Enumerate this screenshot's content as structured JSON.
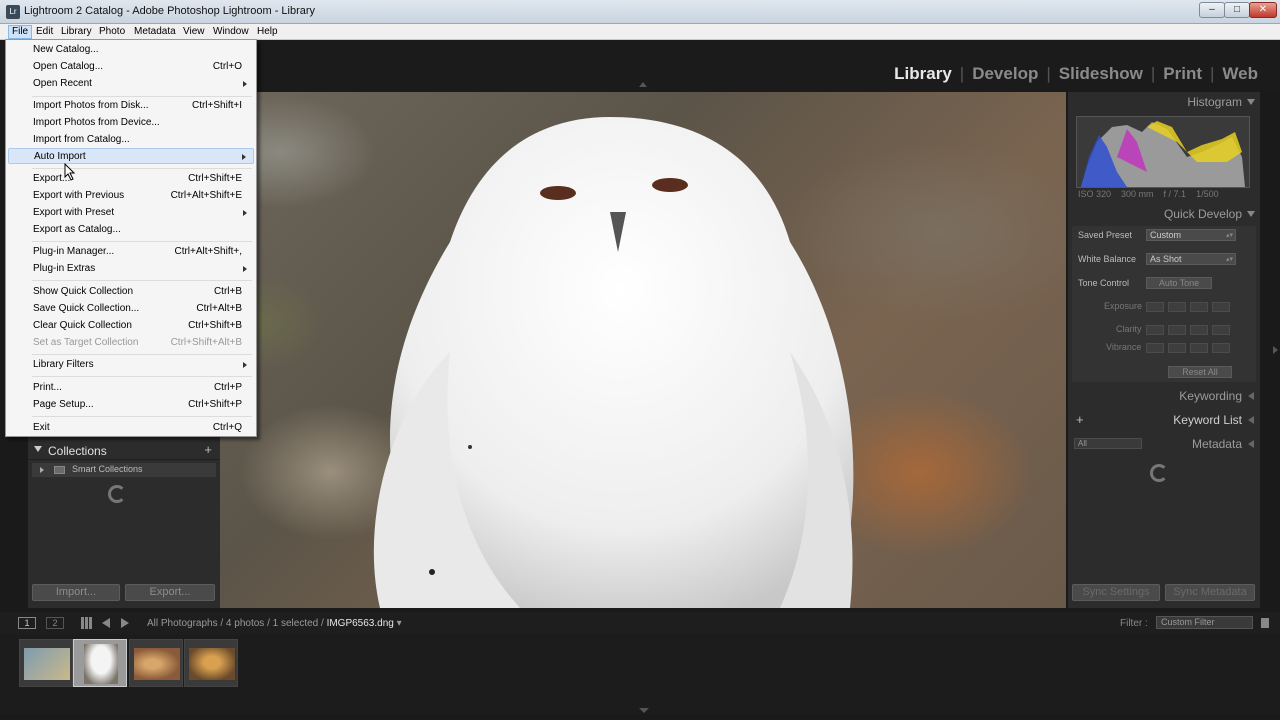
{
  "window": {
    "title": "Lightroom 2 Catalog - Adobe Photoshop Lightroom - Library",
    "app_icon": "Lr",
    "min": "–",
    "max": "□",
    "close": "✕"
  },
  "menubar": [
    "File",
    "Edit",
    "Library",
    "Photo",
    "Metadata",
    "View",
    "Window",
    "Help"
  ],
  "modules": {
    "items": [
      "Library",
      "Develop",
      "Slideshow",
      "Print",
      "Web"
    ],
    "separator": "|",
    "active": "Library"
  },
  "file_menu": [
    {
      "label": "New Catalog...",
      "shortcut": "",
      "submenu": false
    },
    {
      "label": "Open Catalog...",
      "shortcut": "Ctrl+O",
      "submenu": false
    },
    {
      "label": "Open Recent",
      "shortcut": "",
      "submenu": true
    },
    {
      "label": "Import Photos from Disk...",
      "shortcut": "Ctrl+Shift+I",
      "submenu": false
    },
    {
      "label": "Import Photos from Device...",
      "shortcut": "",
      "submenu": false
    },
    {
      "label": "Import from Catalog...",
      "shortcut": "",
      "submenu": false
    },
    {
      "label": "Auto Import",
      "shortcut": "",
      "submenu": true,
      "highlighted": true
    },
    {
      "label": "Export...",
      "shortcut": "Ctrl+Shift+E",
      "submenu": false
    },
    {
      "label": "Export with Previous",
      "shortcut": "Ctrl+Alt+Shift+E",
      "submenu": false
    },
    {
      "label": "Export with Preset",
      "shortcut": "",
      "submenu": true
    },
    {
      "label": "Export as Catalog...",
      "shortcut": "",
      "submenu": false
    },
    {
      "label": "Plug-in Manager...",
      "shortcut": "Ctrl+Alt+Shift+,",
      "submenu": false
    },
    {
      "label": "Plug-in Extras",
      "shortcut": "",
      "submenu": true
    },
    {
      "label": "Show Quick Collection",
      "shortcut": "Ctrl+B",
      "submenu": false
    },
    {
      "label": "Save Quick Collection...",
      "shortcut": "Ctrl+Alt+B",
      "submenu": false
    },
    {
      "label": "Clear Quick Collection",
      "shortcut": "Ctrl+Shift+B",
      "submenu": false
    },
    {
      "label": "Set as Target Collection",
      "shortcut": "Ctrl+Shift+Alt+B",
      "submenu": false,
      "disabled": true
    },
    {
      "label": "Library Filters",
      "shortcut": "",
      "submenu": true
    },
    {
      "label": "Print...",
      "shortcut": "Ctrl+P",
      "submenu": false
    },
    {
      "label": "Page Setup...",
      "shortcut": "Ctrl+Shift+P",
      "submenu": false
    },
    {
      "label": "Exit",
      "shortcut": "Ctrl+Q",
      "submenu": false
    }
  ],
  "left_panel": {
    "collections_title": "Collections",
    "add_icon": "+",
    "smart_collections": "Smart Collections",
    "import_button": "Import...",
    "export_button": "Export..."
  },
  "right_panel": {
    "histogram_title": "Histogram",
    "histogram_info": {
      "iso": "ISO 320",
      "focal": "300 mm",
      "aperture": "f / 7.1",
      "shutter": "1/500"
    },
    "quick_develop_title": "Quick Develop",
    "saved_preset_label": "Saved Preset",
    "saved_preset_value": "Custom",
    "white_balance_label": "White Balance",
    "white_balance_value": "As Shot",
    "tone_control_label": "Tone Control",
    "auto_tone": "Auto Tone",
    "exposure_label": "Exposure",
    "clarity_label": "Clarity",
    "vibrance_label": "Vibrance",
    "reset_all": "Reset All",
    "keywording_title": "Keywording",
    "keyword_list_title": "Keyword List",
    "metadata_title": "Metadata",
    "metadata_preset": "All",
    "sync_settings": "Sync Settings",
    "sync_metadata": "Sync Metadata"
  },
  "filmstrip_bar": {
    "screen1": "1",
    "screen2": "2",
    "breadcrumb_prefix": "All Photographs / 4 photos / 1 selected /",
    "filename": "IMGP6563.dng",
    "filter_label": "Filter :",
    "filter_value": "Custom Filter"
  },
  "thumbnails": [
    {
      "colors": [
        "#7f9bb0",
        "#c9b98a"
      ]
    },
    {
      "colors": [
        "#e8e8e8",
        "#7a7468"
      ],
      "selected": true
    },
    {
      "colors": [
        "#8a5a3a",
        "#d6a66a"
      ]
    },
    {
      "colors": [
        "#6a4a2a",
        "#d8a050"
      ]
    }
  ],
  "colors": {
    "menu_highlight": "#d8e6f7",
    "active_module": "#e8e8e8",
    "inactive_module": "#8a8a8a",
    "panel_bg": "#2c2c2c"
  }
}
